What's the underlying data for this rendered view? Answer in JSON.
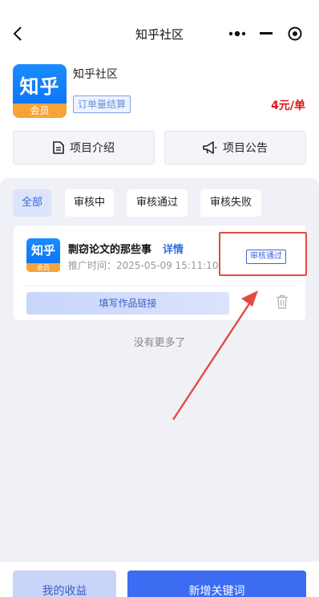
{
  "nav": {
    "title": "知乎社区"
  },
  "product": {
    "logo_main": "知乎",
    "logo_sub": "会员",
    "name": "知乎社区",
    "settle_tag": "订单量结算",
    "price": "4元/单"
  },
  "tabs": {
    "intro": "项目介绍",
    "notice": "项目公告"
  },
  "filters": [
    {
      "label": "全部",
      "active": true
    },
    {
      "label": "审核中",
      "active": false
    },
    {
      "label": "审核通过",
      "active": false
    },
    {
      "label": "审核失败",
      "active": false
    }
  ],
  "items": [
    {
      "logo_main": "知乎",
      "logo_sub": "会员",
      "title": "剽窃论文的那些事",
      "detail_link": "详情",
      "time": "推广时间：2025-05-09 15:11:10",
      "status": "审核通过",
      "link_button": "填写作品链接"
    }
  ],
  "list_footer": "没有更多了",
  "bottom": {
    "income": "我的收益",
    "add_keyword": "新增关键词"
  },
  "colors": {
    "brand_blue": "#3b6cf2",
    "price_red": "#e01515",
    "annotation_red": "#e24c3f",
    "logo_orange": "#f6a43a"
  }
}
